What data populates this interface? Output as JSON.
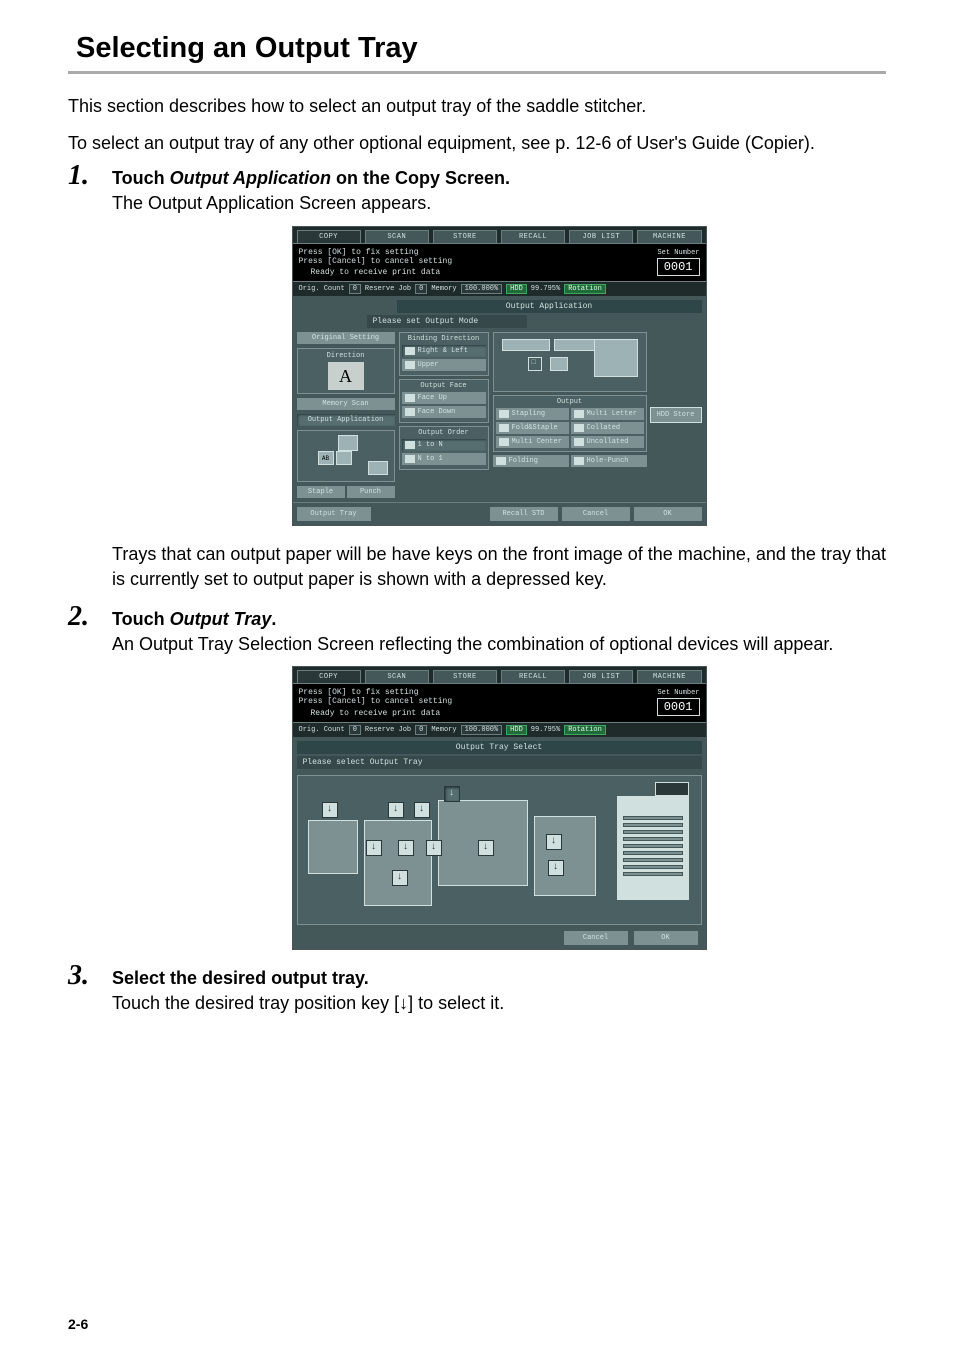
{
  "page": {
    "title": "Selecting an Output Tray",
    "intro1": "This section describes how to select an output tray of the saddle stitcher.",
    "intro2": "To select an output tray of any other optional equipment, see p. 12-6 of User's Guide (Copier).",
    "pageNumber": "2-6"
  },
  "steps": [
    {
      "num": "1.",
      "title_pre": "Touch ",
      "title_em": "Output Application",
      "title_post": " on the Copy Screen.",
      "body1": "The Output Application Screen appears.",
      "body2": "Trays that can output paper will be have keys on the front image of the machine, and the tray that is currently set to output paper is shown with a depressed key."
    },
    {
      "num": "2.",
      "title_pre": "Touch ",
      "title_em": "Output Tray",
      "title_post": ".",
      "body1": "An Output Tray Selection Screen reflecting the combination of optional devices will appear."
    },
    {
      "num": "3.",
      "title_pre": "Select the desired output tray.",
      "title_em": "",
      "title_post": "",
      "body1": "Touch the desired tray position key [↓] to select it."
    }
  ],
  "copier": {
    "tabs": [
      "COPY",
      "SCAN",
      "STORE",
      "RECALL",
      "JOB LIST",
      "MACHINE"
    ],
    "header_line1": "Press [OK] to fix setting",
    "header_line2": "Press [Cancel] to cancel setting",
    "header_sub": "Ready to receive print data",
    "set_number_label": "Set Number",
    "set_number_value": "0001",
    "status": {
      "orig_count": "Orig. Count",
      "orig_count_val": "0",
      "reserve_job": "Reserve Job",
      "reserve_job_val": "0",
      "memory": "Memory",
      "memory_val": "100.000%",
      "hdd": "HDD",
      "hdd_val": "99.795%",
      "rotation": "Rotation"
    },
    "panel_title": "Output Application",
    "subtitle": "Please set Output Mode",
    "left": {
      "orig_setting": "Original Setting",
      "direction": "Direction",
      "a_label": "A",
      "memory_scan": "Memory Scan",
      "output_application": "Output Application",
      "staple": "Staple",
      "punch": "Punch"
    },
    "binding": {
      "title": "Binding Direction",
      "opt1": "Right & Left",
      "opt2": "Upper"
    },
    "output_face": {
      "title": "Output Face",
      "opt1": "Face Up",
      "opt2": "Face Down"
    },
    "output_order": {
      "title": "Output Order",
      "opt1": "1 to N",
      "opt2": "N to 1"
    },
    "output": {
      "title": "Output",
      "stapling": "Stapling",
      "multi_letter": "Multi Letter",
      "fold_staple": "Fold&Staple",
      "collated": "Collated",
      "multi_center": "Multi Center",
      "uncollated": "Uncollated",
      "folding": "Folding",
      "hole_punch": "Hole-Punch"
    },
    "hdd_store": "HDD Store",
    "bottom": {
      "output_tray": "Output Tray",
      "recall_std": "Recall STD",
      "cancel": "Cancel",
      "ok": "OK"
    }
  },
  "tray_screen": {
    "title": "Output Tray Select",
    "subtitle": "Please select Output Tray",
    "arrow": "↓",
    "cancel": "Cancel",
    "ok": "OK"
  }
}
